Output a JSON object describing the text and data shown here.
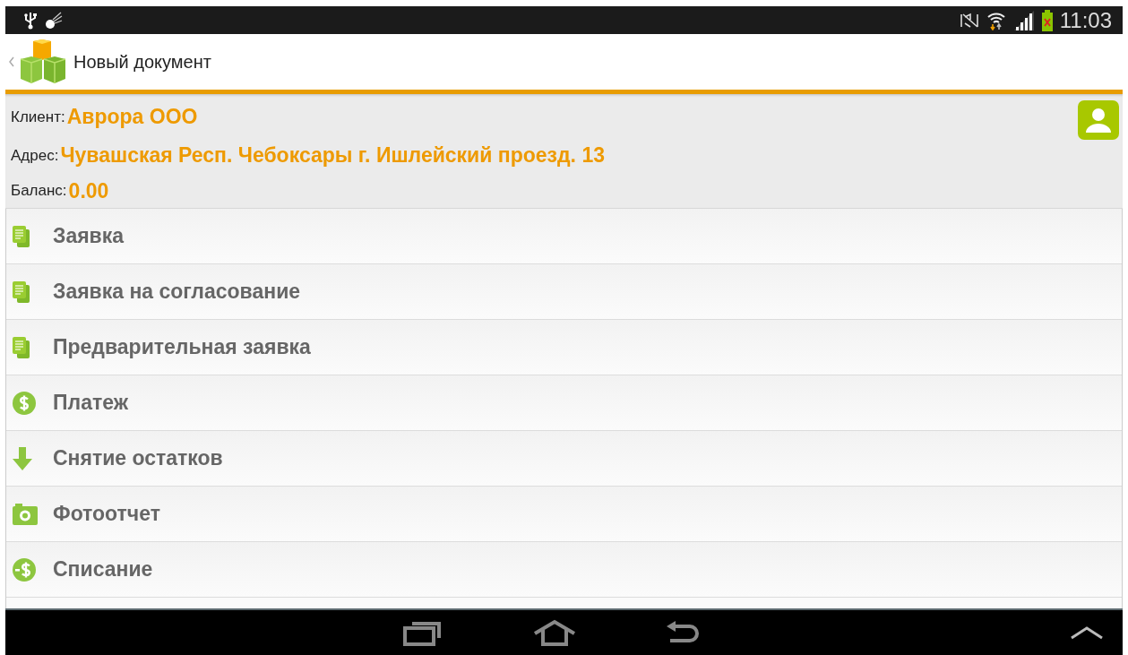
{
  "status_bar": {
    "time": "11:03"
  },
  "action_bar": {
    "title": "Новый документ"
  },
  "client": {
    "fields": [
      {
        "label": "Клиент:",
        "value": "Аврора ООО"
      },
      {
        "label": "Адрес:",
        "value": "Чувашская Респ. Чебоксары г. Ишлейский проезд. 13"
      },
      {
        "label": "Баланс:",
        "value": "0.00"
      }
    ]
  },
  "menu": {
    "items": [
      {
        "kind": "document",
        "label": "Заявка"
      },
      {
        "kind": "document",
        "label": "Заявка на согласование"
      },
      {
        "kind": "document",
        "label": "Предварительная заявка"
      },
      {
        "kind": "payment",
        "label": "Платеж"
      },
      {
        "kind": "download",
        "label": "Снятие остатков"
      },
      {
        "kind": "photo",
        "label": "Фотоотчет"
      },
      {
        "kind": "writeoff",
        "label": "Списание"
      }
    ]
  }
}
